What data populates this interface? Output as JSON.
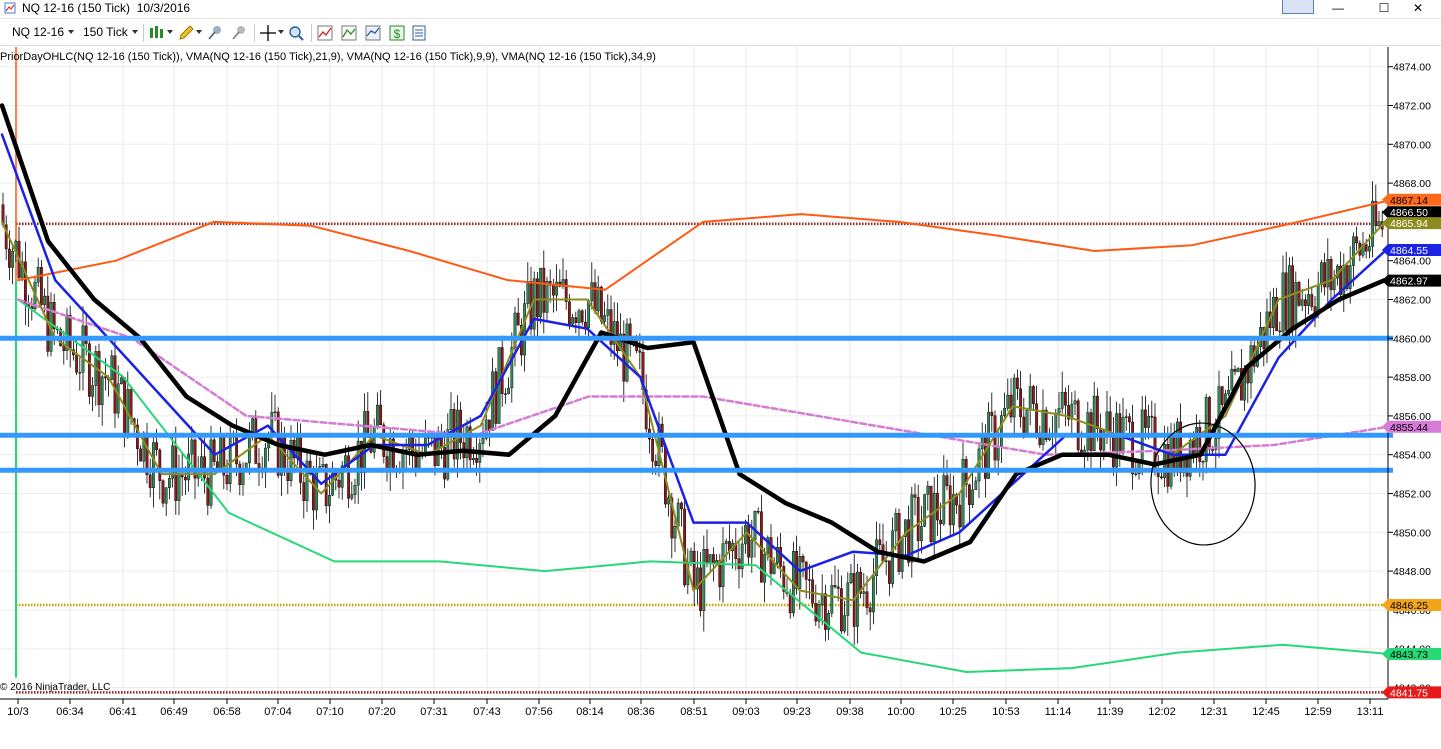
{
  "window": {
    "title": "NQ 12-16 (150 Tick)  10/3/2016",
    "badge": "",
    "minimize": "—",
    "maximize": "☐",
    "close": "✕"
  },
  "toolbar": {
    "instrument": "NQ 12-16",
    "interval": "150 Tick",
    "icons": [
      "bar-type-icon",
      "drawing-pencil-icon",
      "crosshair-icon",
      "zoom-icon",
      "indicators-icon",
      "strategies-icon",
      "chart-properties-icon",
      "data-box-icon"
    ]
  },
  "chart": {
    "indicator_label": "PriorDayOHLC(NQ 12-16 (150 Tick)), VMA(NQ 12-16 (150 Tick),21,9), VMA(NQ 12-16 (150 Tick),9,9), VMA(NQ 12-16 (150 Tick),34,9)",
    "copyright": "© 2016 NinjaTrader, LLC"
  },
  "chart_data": {
    "type": "line",
    "y_axis": {
      "min": 4840,
      "max": 4875,
      "ticks": [
        4874,
        4872,
        4870,
        4868,
        4866,
        4864,
        4862,
        4860,
        4858,
        4856,
        4854,
        4852,
        4850,
        4848,
        4846,
        4844,
        4842
      ]
    },
    "x_axis": {
      "ticks": [
        "10/3",
        "06:34",
        "06:41",
        "06:49",
        "06:58",
        "07:04",
        "07:10",
        "07:20",
        "07:31",
        "07:43",
        "07:56",
        "08:14",
        "08:36",
        "08:51",
        "09:03",
        "09:23",
        "09:38",
        "10:00",
        "10:25",
        "10:53",
        "11:14",
        "11:39",
        "12:02",
        "12:31",
        "12:45",
        "12:59",
        "13:11"
      ]
    },
    "price_markers": [
      {
        "label": "4867.14",
        "value": 4867.14,
        "color": "#ff6a1a"
      },
      {
        "label": "4866.50",
        "value": 4866.5,
        "color": "#000000"
      },
      {
        "label": "4865.94",
        "value": 4865.94,
        "color": "#8c8c1e"
      },
      {
        "label": "4864.55",
        "value": 4864.55,
        "color": "#1a22e6"
      },
      {
        "label": "4862.97",
        "value": 4862.97,
        "color": "#000000"
      },
      {
        "label": "4855.44",
        "value": 4855.44,
        "color": "#d67bd6"
      },
      {
        "label": "4846.25",
        "value": 4846.25,
        "color": "#f2a41a"
      },
      {
        "label": "4843.73",
        "value": 4843.73,
        "color": "#27d877"
      },
      {
        "label": "4841.75",
        "value": 4841.75,
        "color": "#e61a1a"
      }
    ],
    "prior_day_levels": [
      {
        "name": "prior-high",
        "value": 4865.9,
        "color": "#8b2020"
      },
      {
        "name": "prior-close",
        "value": 4846.25,
        "color": "#c9a000"
      },
      {
        "name": "prior-low",
        "value": 4841.75,
        "color": "#8b2020"
      }
    ],
    "horizontal_lines": [
      4860,
      4855,
      4853.2
    ],
    "series": [
      {
        "line": "VMA-34",
        "color": "#000000",
        "values": [
          4872,
          4865,
          4862,
          4860,
          4857,
          4855.5,
          4854.5,
          4854,
          4854.5,
          4854,
          4854.2,
          4854,
          4856,
          4860.3,
          4859.5,
          4859.8,
          4853,
          4851.5,
          4850.5,
          4849,
          4848.5,
          4849.5,
          4853,
          4854,
          4854,
          4853.5,
          4854,
          4858.5,
          4860.5,
          4862,
          4863
        ]
      },
      {
        "line": "VMA-21",
        "color": "#1a22e6",
        "values": [
          4870.5,
          4863,
          4860,
          4857,
          4854,
          4855.5,
          4852.5,
          4854.5,
          4854.5,
          4856,
          4861,
          4860.5,
          4858,
          4850.5,
          4850.5,
          4848,
          4849,
          4848.8,
          4850,
          4852.5,
          4855,
          4855,
          4854,
          4854,
          4859,
          4862,
          4864.5
        ]
      },
      {
        "line": "VMA-9",
        "color": "#8c8c1e",
        "values": [
          4866,
          4860,
          4858,
          4853,
          4853,
          4855,
          4852,
          4855,
          4854,
          4855.5,
          4862,
          4862,
          4858,
          4847,
          4850,
          4847,
          4846.5,
          4850,
          4852,
          4856.5,
          4856,
          4855,
          4854,
          4856,
          4862,
          4863,
          4866
        ]
      },
      {
        "line": "Pivot-Upper",
        "color": "#ff5a14",
        "values": [
          4863,
          4864,
          4866,
          4865.8,
          4864.5,
          4863,
          4862.5,
          4866,
          4866.4,
          4866,
          4865.3,
          4864.5,
          4864.8,
          4865.9,
          4867.1
        ]
      },
      {
        "line": "Pivot-Dashed",
        "color": "#d67bd6",
        "values": [
          4862,
          4860,
          4856,
          4855.5,
          4855,
          4857,
          4857,
          4856,
          4855,
          4854,
          4854.2,
          4854.5,
          4855.44
        ]
      },
      {
        "line": "Pivot-Lower",
        "color": "#27d877",
        "values": [
          4862,
          4858,
          4851,
          4848.5,
          4848.5,
          4848,
          4848.5,
          4848.3,
          4843.8,
          4842.8,
          4843,
          4843.8,
          4844.2,
          4843.73
        ]
      }
    ]
  }
}
